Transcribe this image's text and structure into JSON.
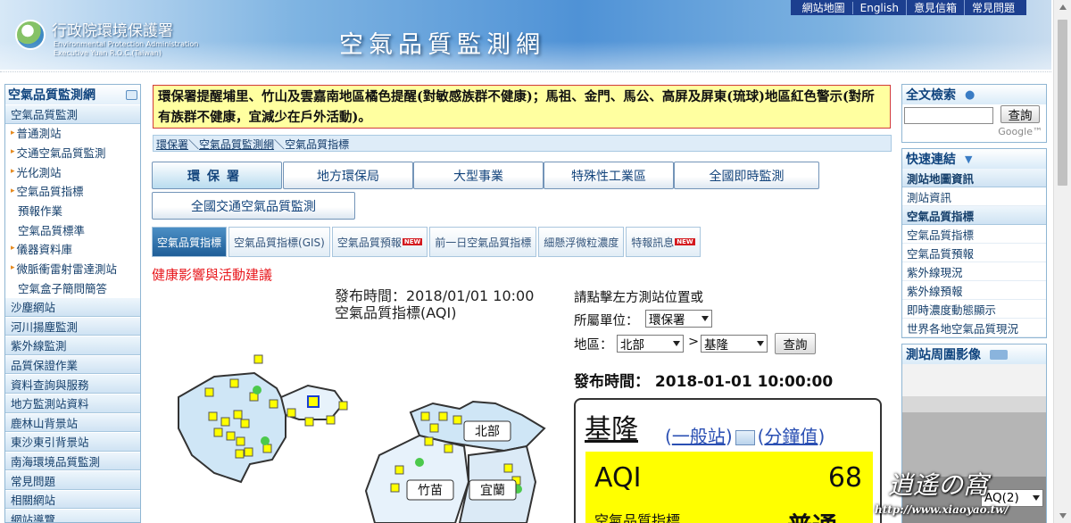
{
  "header": {
    "agency_zh": "行政院環境保護署",
    "agency_en": [
      "Environmental Protection Administration",
      "Executive Yuan R.O.C.(Taiwan)"
    ],
    "site_title": "空氣品質監測網",
    "top_links": [
      "網站地圖",
      "English",
      "意見信箱",
      "常見問題"
    ]
  },
  "left_menu": {
    "title": "空氣品質監測網",
    "items": [
      {
        "label": "空氣品質監測",
        "type": "sec"
      },
      {
        "label": "普通測站",
        "type": "sub"
      },
      {
        "label": "交通空氣品質監測",
        "type": "sub"
      },
      {
        "label": "光化測站",
        "type": "sub"
      },
      {
        "label": "空氣品質指標",
        "type": "sub"
      },
      {
        "label": "預報作業",
        "type": "sub2"
      },
      {
        "label": "空氣品質標準",
        "type": "sub2"
      },
      {
        "label": "儀器資料庫",
        "type": "sub"
      },
      {
        "label": "微脈衝雷射雷達測站",
        "type": "sub"
      },
      {
        "label": "空氣盒子簡問簡答",
        "type": "sub2"
      },
      {
        "label": "沙塵網站",
        "type": "sec"
      },
      {
        "label": "河川揚塵監測",
        "type": "sec"
      },
      {
        "label": "紫外線監測",
        "type": "sec"
      },
      {
        "label": "品質保證作業",
        "type": "sec"
      },
      {
        "label": "資料查詢與服務",
        "type": "sec"
      },
      {
        "label": "地方監測站資料",
        "type": "sec"
      },
      {
        "label": "鹿林山背景站",
        "type": "sec"
      },
      {
        "label": "東沙東引背景站",
        "type": "sec"
      },
      {
        "label": "南海環境品質監測",
        "type": "sec"
      },
      {
        "label": "常見問題",
        "type": "sec"
      },
      {
        "label": "相關網站",
        "type": "sec"
      },
      {
        "label": "網站導覽",
        "type": "sec"
      }
    ]
  },
  "alert": "環保署提醒埔里、竹山及雲嘉南地區橘色提醒(對敏感族群不健康)；馬祖、金門、馬公、高屏及屏東(琉球)地區紅色警示(對所有族群不健康，宜減少在戶外活動)。",
  "breadcrumb": {
    "a": "環保署",
    "b": "空氣品質監測網",
    "c": "空氣品質指標",
    "sep": "＼"
  },
  "tabs": {
    "row1": [
      "環保署",
      "地方環保局",
      "大型事業",
      "特殊性工業區",
      "全國即時監測"
    ],
    "row2": [
      "全國交通空氣品質監測"
    ]
  },
  "subtabs": [
    {
      "label": "空氣品質指標",
      "new": false
    },
    {
      "label": "空氣品質指標(GIS)",
      "new": false
    },
    {
      "label": "空氣品質預報",
      "new": true
    },
    {
      "label": "前一日空氣品質指標",
      "new": false
    },
    {
      "label": "細懸浮微粒濃度",
      "new": false
    },
    {
      "label": "特報訊息",
      "new": true
    }
  ],
  "new_badge": "NEW",
  "health_heading": "健康影響與活動建議",
  "publish": {
    "time_line": "發布時間：2018/01/01 10:00",
    "label": "空氣品質指標(AQI)",
    "time2": "發布時間：  2018-01-01 10:00:00"
  },
  "filter": {
    "hint": "請點擊左方測站位置或",
    "unit_label": "所屬單位：",
    "unit_value": "環保署",
    "area_label": "地區：",
    "area_value": "北部",
    "gt": ">",
    "county_value": "基隆",
    "query": "查詢"
  },
  "map_labels": [
    "北部",
    "竹苗",
    "宜蘭"
  ],
  "station": {
    "name": "基隆",
    "type_link": "一般站",
    "minute_link": "分鐘值",
    "paren_open": "(",
    "paren_close": ")",
    "aqi_label": "AQI",
    "aqi_value": "68",
    "index_label": "空氣品質指標",
    "status": "普通"
  },
  "right": {
    "search_title": "全文檢索",
    "search_btn": "查詢",
    "google": "Google™",
    "quick_title": "快速連結",
    "quick_items": [
      {
        "label": "測站地圖資訊",
        "h": true
      },
      {
        "label": "測站資訊",
        "h": false
      },
      {
        "label": "空氣品質指標",
        "h": true
      },
      {
        "label": "空氣品質指標",
        "h": false
      },
      {
        "label": "空氣品質預報",
        "h": false
      },
      {
        "label": "紫外線現況",
        "h": false
      },
      {
        "label": "紫外線預報",
        "h": false
      },
      {
        "label": "即時濃度動態顯示",
        "h": false
      },
      {
        "label": "世界各地空氣品質現況",
        "h": false
      }
    ],
    "photo_title": "測站周圍影像",
    "photo_sel": "AQ(2)"
  },
  "watermark": {
    "name": "逍遙の窩",
    "url": "http://www.xiaoyao.tw/"
  },
  "colors": {
    "good": "#4cc94c",
    "moderate": "#ffff00",
    "banner": "#4f92d6"
  }
}
